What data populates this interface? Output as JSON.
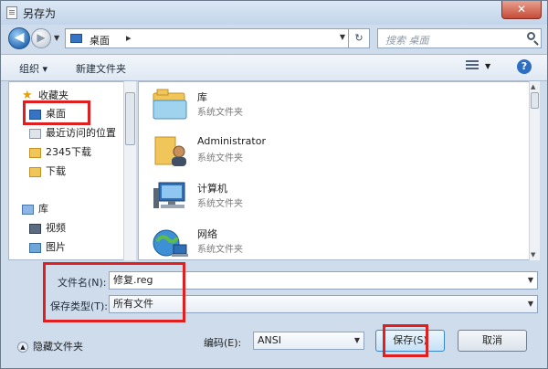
{
  "window": {
    "title": "另存为",
    "close_glyph": "✕"
  },
  "navbar": {
    "back_glyph": "◀",
    "forward_glyph": "▶",
    "address_path": "桌面",
    "address_sep": "▸",
    "refresh_glyph": "↻",
    "search_placeholder": "搜索 桌面"
  },
  "toolbar": {
    "organize_label": "组织 ▾",
    "new_folder_label": "新建文件夹",
    "help_glyph": "?"
  },
  "nav_pane": {
    "items": [
      {
        "label": "收藏夹",
        "icon": "star-icon"
      },
      {
        "label": "桌面",
        "icon": "desktop-icon"
      },
      {
        "label": "最近访问的位置",
        "icon": "recent-places-icon"
      },
      {
        "label": "2345下载",
        "icon": "folder-icon"
      },
      {
        "label": "下载",
        "icon": "downloads-icon"
      },
      {
        "label": "库",
        "icon": "library-icon"
      },
      {
        "label": "视频",
        "icon": "video-icon"
      },
      {
        "label": "图片",
        "icon": "pictures-icon"
      }
    ]
  },
  "files": [
    {
      "name": "库",
      "type": "系统文件夹",
      "icon": "library-icon"
    },
    {
      "name": "Administrator",
      "type": "系统文件夹",
      "icon": "user-folder-icon"
    },
    {
      "name": "计算机",
      "type": "系统文件夹",
      "icon": "computer-icon"
    },
    {
      "name": "网络",
      "type": "系统文件夹",
      "icon": "network-icon"
    }
  ],
  "form": {
    "filename_label": "文件名(N):",
    "filename_value": "修复.reg",
    "filetype_label": "保存类型(T):",
    "filetype_value": "所有文件",
    "encoding_label": "编码(E):",
    "encoding_value": "ANSI"
  },
  "footer": {
    "hide_folders_label": "隐藏文件夹",
    "save_label": "保存(S)",
    "cancel_label": "取消"
  },
  "colors": {
    "highlight": "#e02020",
    "accent": "#3574c4"
  }
}
